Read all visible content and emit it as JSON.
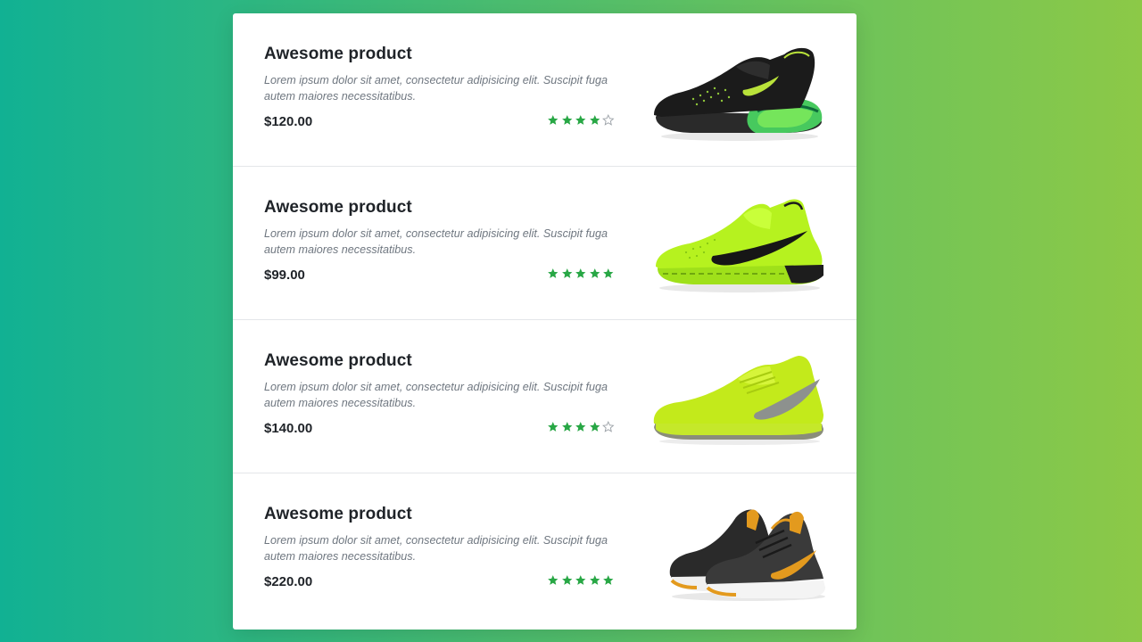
{
  "colors": {
    "accent_star": "#28a745",
    "empty_star_stroke": "#9aa0a6",
    "title_text": "#1f2328",
    "desc_text": "#6f7780"
  },
  "products": [
    {
      "title": "Awesome product",
      "description": "Lorem ipsum dolor sit amet, consectetur adipisicing elit. Suscipit fuga autem maiores necessitatibus.",
      "price": "$120.00",
      "rating": 4,
      "rating_max": 5,
      "image_icon": "black-green-sneaker-icon"
    },
    {
      "title": "Awesome product",
      "description": "Lorem ipsum dolor sit amet, consectetur adipisicing elit. Suscipit fuga autem maiores necessitatibus.",
      "price": "$99.00",
      "rating": 5,
      "rating_max": 5,
      "image_icon": "neon-green-sneaker-icon"
    },
    {
      "title": "Awesome product",
      "description": "Lorem ipsum dolor sit amet, consectetur adipisicing elit. Suscipit fuga autem maiores necessitatibus.",
      "price": "$140.00",
      "rating": 4,
      "rating_max": 5,
      "image_icon": "lime-tennis-shoe-icon"
    },
    {
      "title": "Awesome product",
      "description": "Lorem ipsum dolor sit amet, consectetur adipisicing elit. Suscipit fuga autem maiores necessitatibus.",
      "price": "$220.00",
      "rating": 5,
      "rating_max": 5,
      "image_icon": "black-orange-sneakers-pair-icon"
    }
  ]
}
